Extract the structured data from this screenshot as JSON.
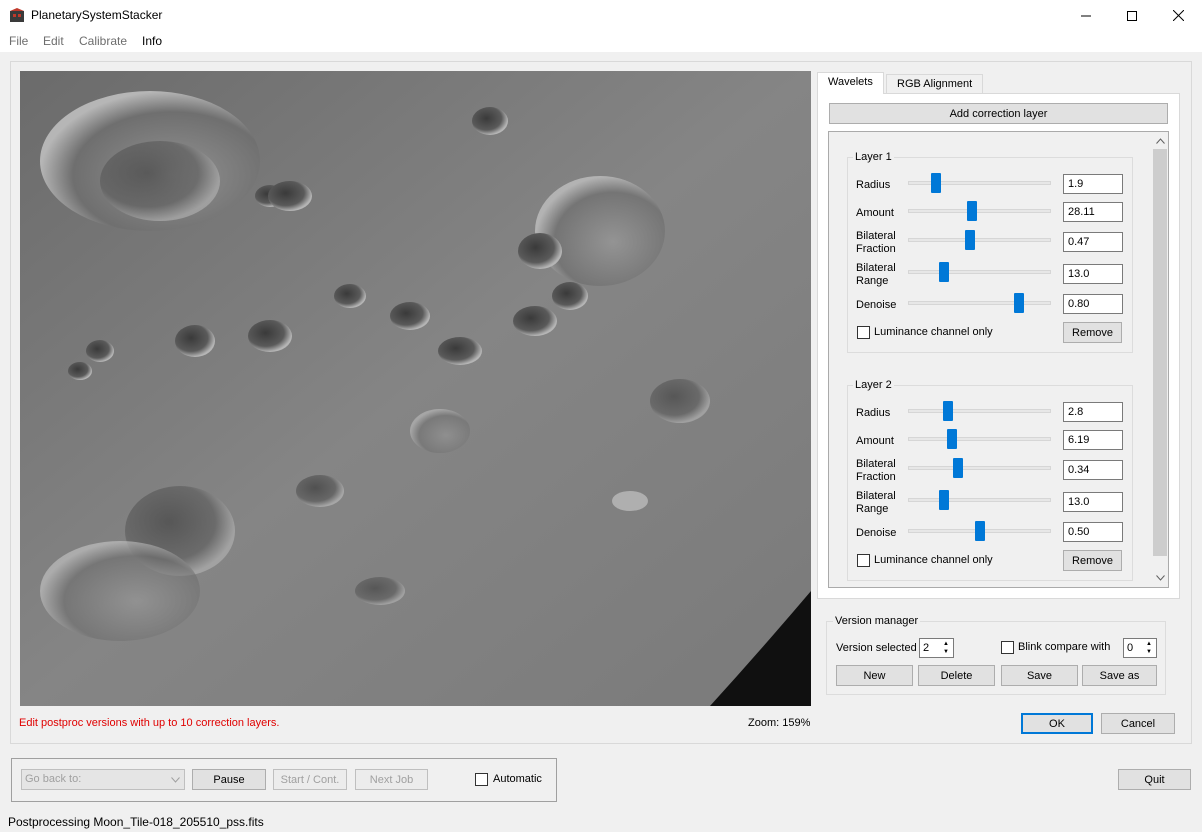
{
  "window": {
    "title": "PlanetarySystemStacker",
    "controls": {
      "minimize": "—",
      "maximize": "☐",
      "close": "✕"
    }
  },
  "menu": [
    "File",
    "Edit",
    "Calibrate",
    "Info"
  ],
  "viewer": {
    "message": "Edit postproc versions with up to 10 correction layers.",
    "zoom": "Zoom: 159%"
  },
  "tabs": {
    "wavelets": "Wavelets",
    "rgb": "RGB Alignment"
  },
  "add_layer_label": "Add correction layer",
  "layers": [
    {
      "title": "Layer 1",
      "labels": {
        "radius": "Radius",
        "amount": "Amount",
        "bf1": "Bilateral",
        "bf2": "Fraction",
        "br1": "Bilateral",
        "br2": "Range",
        "denoise": "Denoise"
      },
      "values": {
        "radius": "1.9",
        "amount": "28.11",
        "fraction": "0.47",
        "range": "13.0",
        "denoise": "0.80"
      },
      "slider_fraction": {
        "radius": 0.17,
        "amount": 0.44,
        "fraction": 0.43,
        "range": 0.23,
        "denoise": 0.8
      },
      "luminance": "Luminance channel only",
      "remove": "Remove"
    },
    {
      "title": "Layer 2",
      "labels": {
        "radius": "Radius",
        "amount": "Amount",
        "bf1": "Bilateral",
        "bf2": "Fraction",
        "br1": "Bilateral",
        "br2": "Range",
        "denoise": "Denoise"
      },
      "values": {
        "radius": "2.8",
        "amount": "6.19",
        "fraction": "0.34",
        "range": "13.0",
        "denoise": "0.50"
      },
      "slider_fraction": {
        "radius": 0.26,
        "amount": 0.29,
        "fraction": 0.34,
        "range": 0.23,
        "denoise": 0.5
      },
      "luminance": "Luminance channel only",
      "remove": "Remove"
    }
  ],
  "version_manager": {
    "title": "Version manager",
    "selected_label": "Version selected",
    "selected_value": "2",
    "blink_label": "Blink compare with",
    "blink_value": "0",
    "buttons": {
      "new": "New",
      "delete": "Delete",
      "save": "Save",
      "save_as": "Save as"
    }
  },
  "dialog_buttons": {
    "ok": "OK",
    "cancel": "Cancel"
  },
  "bottom": {
    "go_back_placeholder": "Go back to:",
    "pause": "Pause",
    "start": "Start / Cont.",
    "next": "Next Job",
    "automatic": "Automatic",
    "quit": "Quit"
  },
  "status": "Postprocessing Moon_Tile-018_205510_pss.fits",
  "colors": {
    "accent": "#0078d7",
    "message": "#e00000"
  }
}
